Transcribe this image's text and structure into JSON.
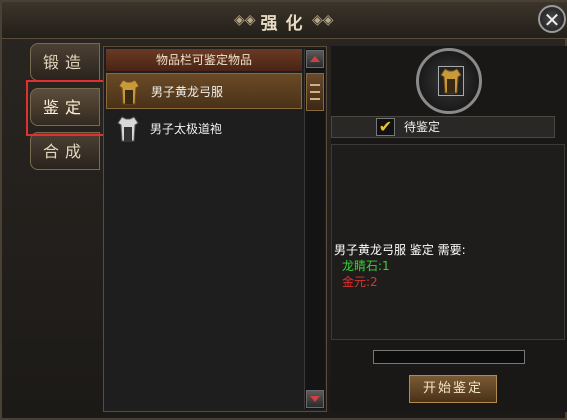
{
  "window": {
    "title": "强化",
    "close_label": "✕"
  },
  "tabs": [
    {
      "label": "锻造",
      "active": false
    },
    {
      "label": "鉴定",
      "active": true
    },
    {
      "label": "合成",
      "active": false
    }
  ],
  "item_list": {
    "header": "物品栏可鉴定物品",
    "items": [
      {
        "label": "男子黄龙弓服",
        "icon": "robe-icon",
        "selected": true
      },
      {
        "label": "男子太极道袍",
        "icon": "robe-icon",
        "selected": false
      }
    ]
  },
  "detail": {
    "pending_label": "待鉴定",
    "pending_checked": true,
    "requirement_title": "男子黄龙弓服 鉴定 需要:",
    "requirements": [
      {
        "text": "龙睛石:1",
        "color": "#39d039"
      },
      {
        "text": "金元:2",
        "color": "#e03030"
      }
    ],
    "start_button": "开始鉴定",
    "progress_value": 0
  },
  "colors": {
    "accent": "#e03030",
    "tab_text": "#e4d6bc"
  }
}
